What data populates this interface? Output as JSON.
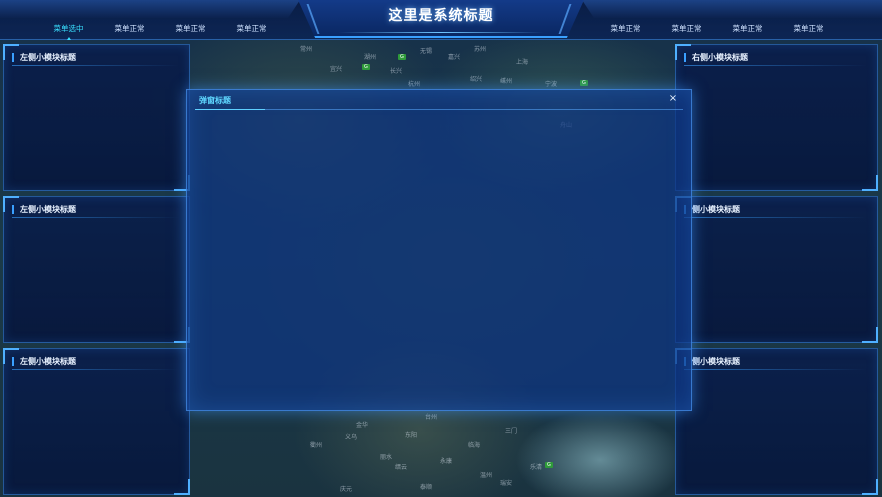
{
  "header": {
    "title": "这里是系统标题",
    "nav_left": [
      {
        "label": "菜单选中",
        "active": true
      },
      {
        "label": "菜单正常",
        "active": false
      },
      {
        "label": "菜单正常",
        "active": false
      },
      {
        "label": "菜单正常",
        "active": false
      }
    ],
    "nav_right": [
      {
        "label": "菜单正常"
      },
      {
        "label": "菜单正常"
      },
      {
        "label": "菜单正常"
      },
      {
        "label": "菜单正常"
      }
    ]
  },
  "left_panels": [
    {
      "title": "左侧小模块标题"
    },
    {
      "title": "左侧小模块标题"
    },
    {
      "title": "左侧小模块标题"
    }
  ],
  "right_panels": [
    {
      "title": "右侧小模块标题"
    },
    {
      "title": "侧小模块标题"
    },
    {
      "title": "侧小模块标题"
    }
  ],
  "dialog": {
    "title": "弹窗标题",
    "close_icon": "×"
  },
  "map_labels": [
    "嘉兴",
    "杭州",
    "湖州",
    "上海",
    "绍兴",
    "宁波",
    "金华",
    "台州",
    "温州",
    "丽水",
    "衢州",
    "舟山",
    "常州",
    "苏州",
    "无锡",
    "宜兴",
    "长兴",
    "嵊州",
    "义乌",
    "东阳",
    "临海",
    "三门",
    "乐清",
    "瑞安",
    "泰顺",
    "庆元",
    "缙云",
    "永康"
  ],
  "colors": {
    "accent": "#39e0ff",
    "panel_border": "#3c8ce6",
    "dialog_bg": "#0e3482"
  }
}
